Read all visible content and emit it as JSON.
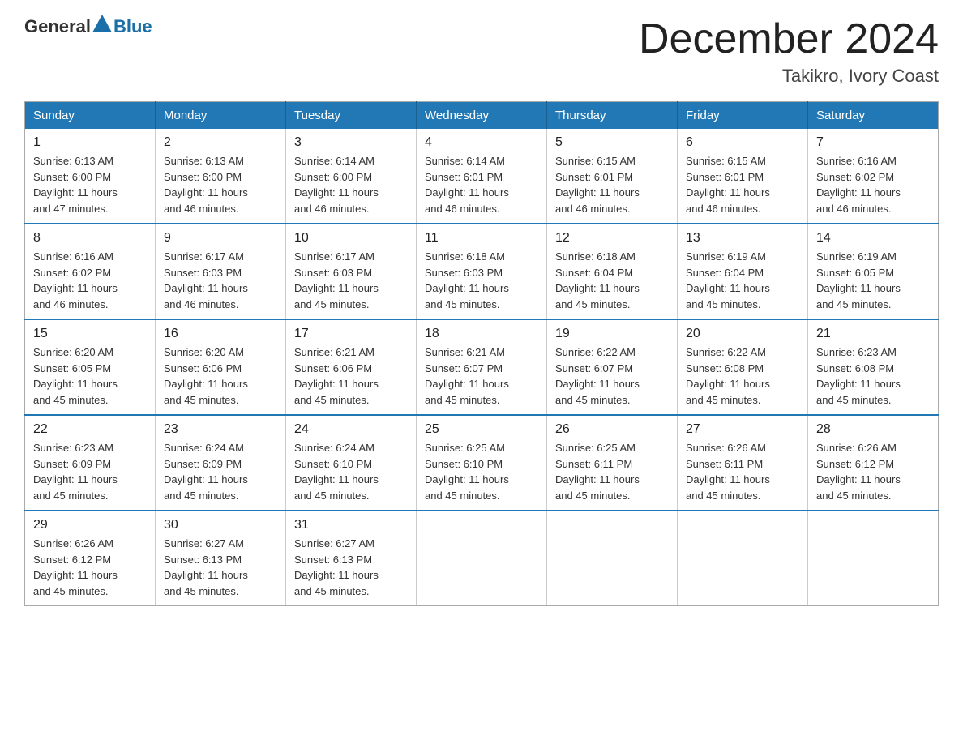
{
  "logo": {
    "general": "General",
    "blue": "Blue"
  },
  "title": "December 2024",
  "subtitle": "Takikro, Ivory Coast",
  "days_of_week": [
    "Sunday",
    "Monday",
    "Tuesday",
    "Wednesday",
    "Thursday",
    "Friday",
    "Saturday"
  ],
  "weeks": [
    [
      {
        "day": "1",
        "sunrise": "6:13 AM",
        "sunset": "6:00 PM",
        "daylight": "11 hours and 47 minutes."
      },
      {
        "day": "2",
        "sunrise": "6:13 AM",
        "sunset": "6:00 PM",
        "daylight": "11 hours and 46 minutes."
      },
      {
        "day": "3",
        "sunrise": "6:14 AM",
        "sunset": "6:00 PM",
        "daylight": "11 hours and 46 minutes."
      },
      {
        "day": "4",
        "sunrise": "6:14 AM",
        "sunset": "6:01 PM",
        "daylight": "11 hours and 46 minutes."
      },
      {
        "day": "5",
        "sunrise": "6:15 AM",
        "sunset": "6:01 PM",
        "daylight": "11 hours and 46 minutes."
      },
      {
        "day": "6",
        "sunrise": "6:15 AM",
        "sunset": "6:01 PM",
        "daylight": "11 hours and 46 minutes."
      },
      {
        "day": "7",
        "sunrise": "6:16 AM",
        "sunset": "6:02 PM",
        "daylight": "11 hours and 46 minutes."
      }
    ],
    [
      {
        "day": "8",
        "sunrise": "6:16 AM",
        "sunset": "6:02 PM",
        "daylight": "11 hours and 46 minutes."
      },
      {
        "day": "9",
        "sunrise": "6:17 AM",
        "sunset": "6:03 PM",
        "daylight": "11 hours and 46 minutes."
      },
      {
        "day": "10",
        "sunrise": "6:17 AM",
        "sunset": "6:03 PM",
        "daylight": "11 hours and 45 minutes."
      },
      {
        "day": "11",
        "sunrise": "6:18 AM",
        "sunset": "6:03 PM",
        "daylight": "11 hours and 45 minutes."
      },
      {
        "day": "12",
        "sunrise": "6:18 AM",
        "sunset": "6:04 PM",
        "daylight": "11 hours and 45 minutes."
      },
      {
        "day": "13",
        "sunrise": "6:19 AM",
        "sunset": "6:04 PM",
        "daylight": "11 hours and 45 minutes."
      },
      {
        "day": "14",
        "sunrise": "6:19 AM",
        "sunset": "6:05 PM",
        "daylight": "11 hours and 45 minutes."
      }
    ],
    [
      {
        "day": "15",
        "sunrise": "6:20 AM",
        "sunset": "6:05 PM",
        "daylight": "11 hours and 45 minutes."
      },
      {
        "day": "16",
        "sunrise": "6:20 AM",
        "sunset": "6:06 PM",
        "daylight": "11 hours and 45 minutes."
      },
      {
        "day": "17",
        "sunrise": "6:21 AM",
        "sunset": "6:06 PM",
        "daylight": "11 hours and 45 minutes."
      },
      {
        "day": "18",
        "sunrise": "6:21 AM",
        "sunset": "6:07 PM",
        "daylight": "11 hours and 45 minutes."
      },
      {
        "day": "19",
        "sunrise": "6:22 AM",
        "sunset": "6:07 PM",
        "daylight": "11 hours and 45 minutes."
      },
      {
        "day": "20",
        "sunrise": "6:22 AM",
        "sunset": "6:08 PM",
        "daylight": "11 hours and 45 minutes."
      },
      {
        "day": "21",
        "sunrise": "6:23 AM",
        "sunset": "6:08 PM",
        "daylight": "11 hours and 45 minutes."
      }
    ],
    [
      {
        "day": "22",
        "sunrise": "6:23 AM",
        "sunset": "6:09 PM",
        "daylight": "11 hours and 45 minutes."
      },
      {
        "day": "23",
        "sunrise": "6:24 AM",
        "sunset": "6:09 PM",
        "daylight": "11 hours and 45 minutes."
      },
      {
        "day": "24",
        "sunrise": "6:24 AM",
        "sunset": "6:10 PM",
        "daylight": "11 hours and 45 minutes."
      },
      {
        "day": "25",
        "sunrise": "6:25 AM",
        "sunset": "6:10 PM",
        "daylight": "11 hours and 45 minutes."
      },
      {
        "day": "26",
        "sunrise": "6:25 AM",
        "sunset": "6:11 PM",
        "daylight": "11 hours and 45 minutes."
      },
      {
        "day": "27",
        "sunrise": "6:26 AM",
        "sunset": "6:11 PM",
        "daylight": "11 hours and 45 minutes."
      },
      {
        "day": "28",
        "sunrise": "6:26 AM",
        "sunset": "6:12 PM",
        "daylight": "11 hours and 45 minutes."
      }
    ],
    [
      {
        "day": "29",
        "sunrise": "6:26 AM",
        "sunset": "6:12 PM",
        "daylight": "11 hours and 45 minutes."
      },
      {
        "day": "30",
        "sunrise": "6:27 AM",
        "sunset": "6:13 PM",
        "daylight": "11 hours and 45 minutes."
      },
      {
        "day": "31",
        "sunrise": "6:27 AM",
        "sunset": "6:13 PM",
        "daylight": "11 hours and 45 minutes."
      },
      null,
      null,
      null,
      null
    ]
  ],
  "labels": {
    "sunrise": "Sunrise:",
    "sunset": "Sunset:",
    "daylight": "Daylight:"
  }
}
